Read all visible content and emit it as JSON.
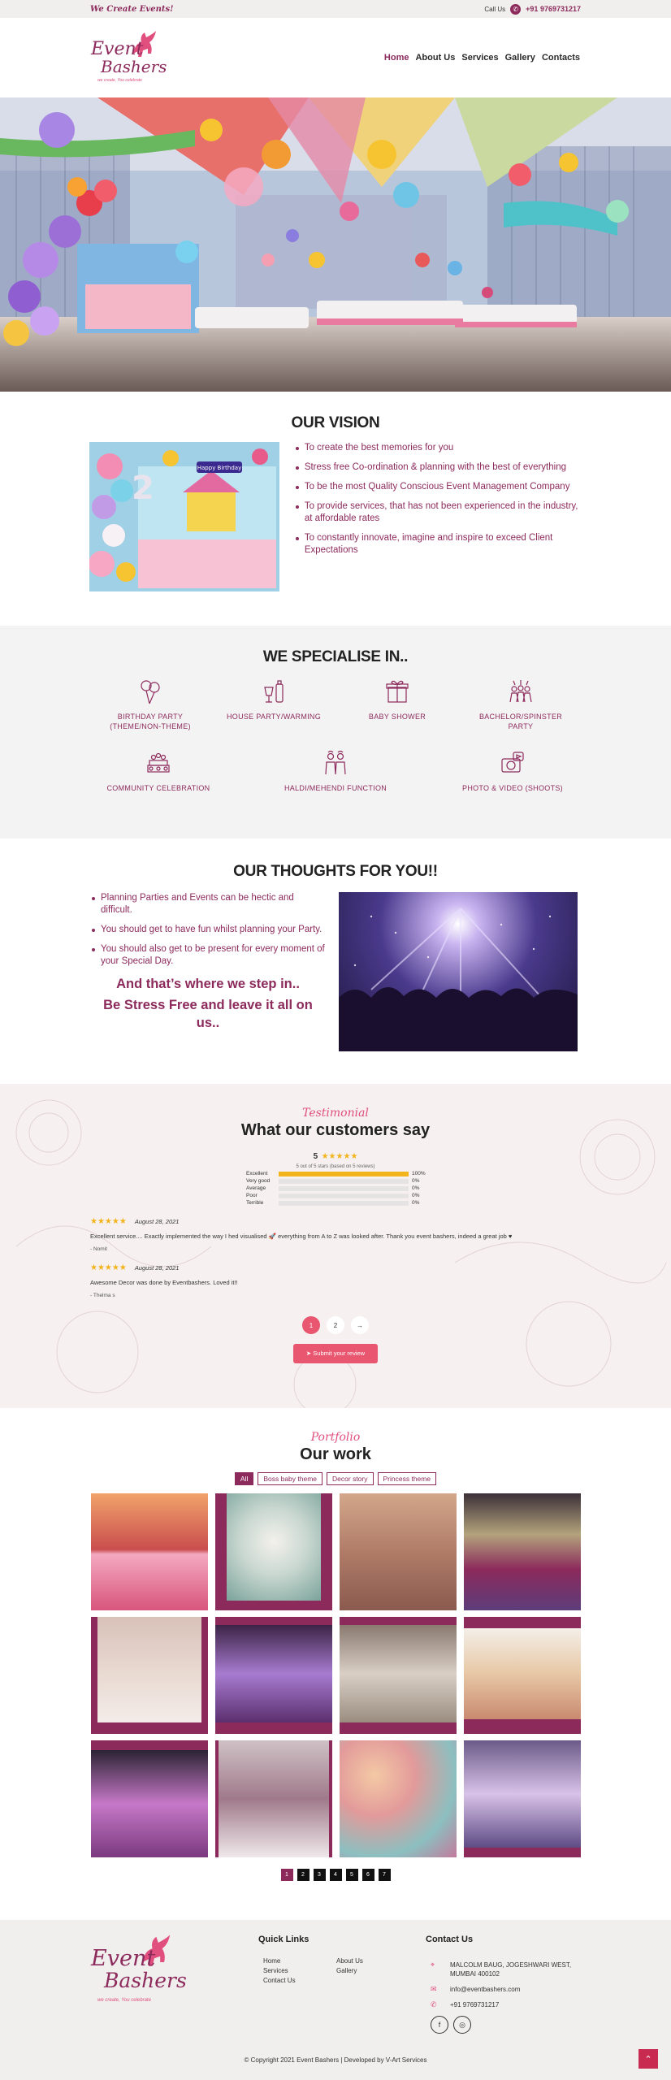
{
  "topbar": {
    "tagline": "We Create Events!",
    "call_label": "Call Us",
    "phone": "+91 9769731217"
  },
  "brand": {
    "line1": "Event",
    "line2": "Bashers",
    "tagline": "we create, You celebrate",
    "accent": "#8c2a5c"
  },
  "nav": [
    {
      "label": "Home",
      "active": true
    },
    {
      "label": "About Us",
      "active": false
    },
    {
      "label": "Services",
      "active": false
    },
    {
      "label": "Gallery",
      "active": false
    },
    {
      "label": "Contacts",
      "active": false
    }
  ],
  "vision": {
    "title": "OUR VISION",
    "banner": "Happy Birthday",
    "points": [
      "To create the best memories for you",
      "Stress free Co-ordination & planning with the best of everything",
      "To be the most Quality Conscious Event Management Company",
      "To provide services, that has not been experienced in the industry, at affordable rates",
      "To constantly innovate, imagine and inspire to exceed Client Expectations"
    ]
  },
  "specialise": {
    "title": "WE SPECIALISE IN..",
    "items": [
      {
        "label": "BIRTHDAY PARTY\n(THEME/NON-THEME)",
        "icon": "balloons-icon"
      },
      {
        "label": "HOUSE PARTY/WARMING",
        "icon": "drinks-icon"
      },
      {
        "label": "BABY SHOWER",
        "icon": "gift-icon"
      },
      {
        "label": "BACHELOR/SPINSTER PARTY",
        "icon": "group-cheers-icon"
      },
      {
        "label": "COMMUNITY CELEBRATION",
        "icon": "community-icon"
      },
      {
        "label": "HALDI/MEHENDI FUNCTION",
        "icon": "couple-icon"
      },
      {
        "label": "PHOTO & VIDEO (SHOOTS)",
        "icon": "camera-icon"
      }
    ]
  },
  "thoughts": {
    "title": "OUR THOUGHTS FOR YOU!!",
    "points": [
      "Planning Parties and Events can be hectic and difficult.",
      "You should get to have fun whilst planning your Party.",
      "You should also get to be present for every moment of your Special Day."
    ],
    "call_line1": "And that’s where we step in..",
    "call_line2": "Be Stress Free and leave it all on us.."
  },
  "testimonial": {
    "script_title": "Testimonial",
    "title": "What our customers say",
    "score": "5",
    "summary": "5 out of 5 stars (based on 5 reviews)",
    "bars": [
      {
        "label": "Excellent",
        "pct": "100%",
        "value": 1.0
      },
      {
        "label": "Very good",
        "pct": "0%",
        "value": 0
      },
      {
        "label": "Average",
        "pct": "0%",
        "value": 0
      },
      {
        "label": "Poor",
        "pct": "0%",
        "value": 0
      },
      {
        "label": "Terrible",
        "pct": "0%",
        "value": 0
      }
    ],
    "reviews": [
      {
        "date": "August 28, 2021",
        "text": "Excellent service.... Exactly implemented the way I hed visualised 🚀 everything from A to Z was looked after. Thank you event bashers, indeed a great job ♥",
        "author": "- Nomit",
        "stars": 5
      },
      {
        "date": "August 28, 2021",
        "text": "Awesome Decor was done by Eventbashers. Loved it!!",
        "author": "- Thelma s",
        "stars": 5
      }
    ],
    "pages": [
      "1",
      "2",
      "→"
    ],
    "current_page": "1",
    "submit_label": "Submit your review"
  },
  "portfolio": {
    "script_title": "Portfolio",
    "title": "Our work",
    "filters": [
      {
        "label": "All",
        "active": true
      },
      {
        "label": "Boss baby theme",
        "active": false
      },
      {
        "label": "Decor story",
        "active": false
      },
      {
        "label": "Princess theme",
        "active": false
      }
    ],
    "pages": [
      "1",
      "2",
      "3",
      "4",
      "5",
      "6",
      "7"
    ],
    "current_page": "1"
  },
  "footer": {
    "quick_links_title": "Quick Links",
    "links": [
      "Home",
      "About Us",
      "Services",
      "Gallery",
      "Contact Us"
    ],
    "contact_title": "Contact Us",
    "address": "MALCOLM BAUG, JOGESHWARI WEST, MUMBAI 400102",
    "email": "info@eventbashers.com",
    "phone": "+91 9769731217",
    "copyright": "© Copyright 2021 Event Bashers | Developed by V-Art Services"
  }
}
